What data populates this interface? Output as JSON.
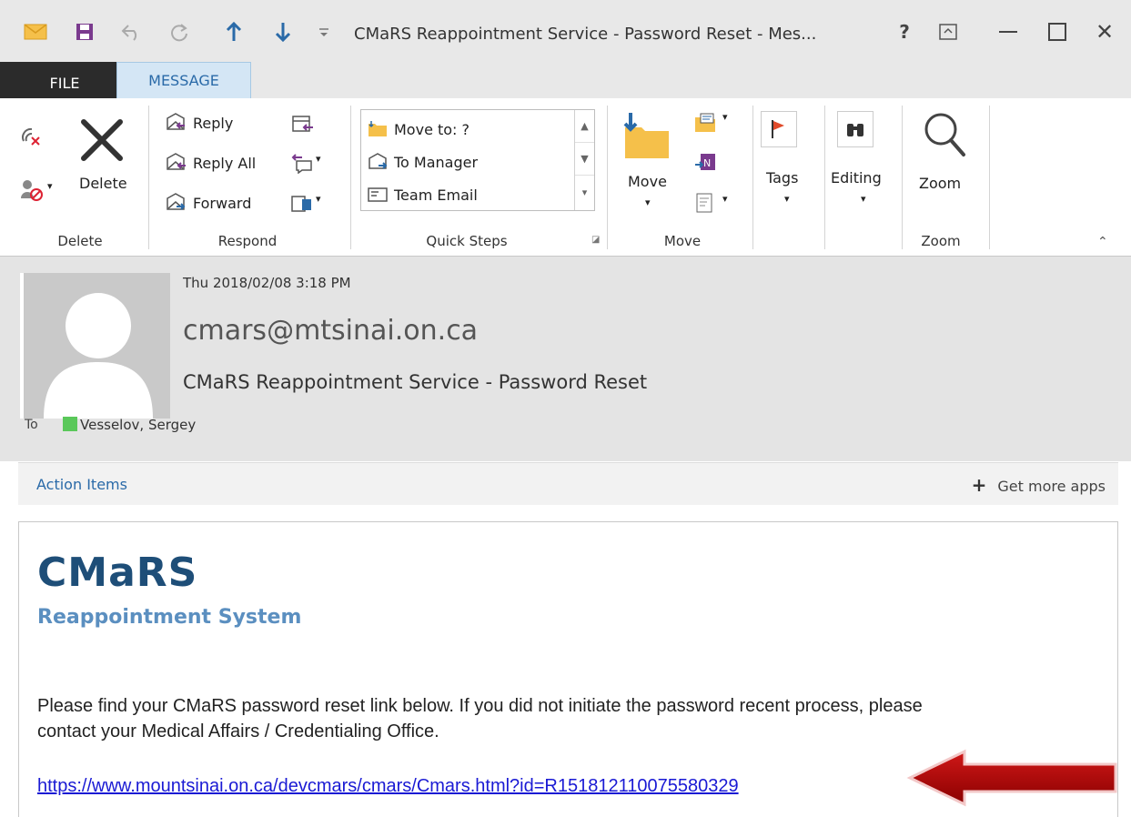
{
  "window": {
    "title": "CMaRS Reappointment Service - Password Reset - Mes...",
    "help": "?",
    "minimize": "—",
    "close": "✕"
  },
  "tabs": [
    {
      "label": "FILE"
    },
    {
      "label": "MESSAGE"
    }
  ],
  "ribbon": {
    "delete_group": {
      "label": "Delete",
      "delete_button": "Delete"
    },
    "respond_group": {
      "label": "Respond",
      "reply": "Reply",
      "reply_all": "Reply All",
      "forward": "Forward"
    },
    "quick_steps": {
      "label": "Quick Steps",
      "items": [
        "Move to: ?",
        "To Manager",
        "Team Email"
      ]
    },
    "move_group": {
      "label": "Move",
      "move_button": "Move"
    },
    "tags": {
      "label": "Tags"
    },
    "editing": {
      "label": "Editing"
    },
    "zoom_group": {
      "label": "Zoom",
      "zoom_button": "Zoom"
    }
  },
  "message": {
    "date": "Thu 2018/02/08 3:18 PM",
    "sender": "cmars@mtsinai.on.ca",
    "subject": "CMaRS Reappointment Service - Password Reset",
    "to_label": "To",
    "to_name": "Vesselov, Sergey",
    "presence_color": "#5ac85a"
  },
  "action_bar": {
    "action_items": "Action Items",
    "get_more_apps": "Get more apps"
  },
  "body": {
    "logo_title": "CMaRS",
    "logo_subtitle": "Reappointment System",
    "text": "Please find your CMaRS password reset link below. If you did not initiate the password recent process, please contact your Medical Affairs / Credentialing Office.",
    "link": "https://www.mountsinai.on.ca/devcmars/cmars/Cmars.html?id=R151812110075580329"
  },
  "colors": {
    "accent": "#2a6aa8",
    "annotation_arrow": "#c00000"
  }
}
